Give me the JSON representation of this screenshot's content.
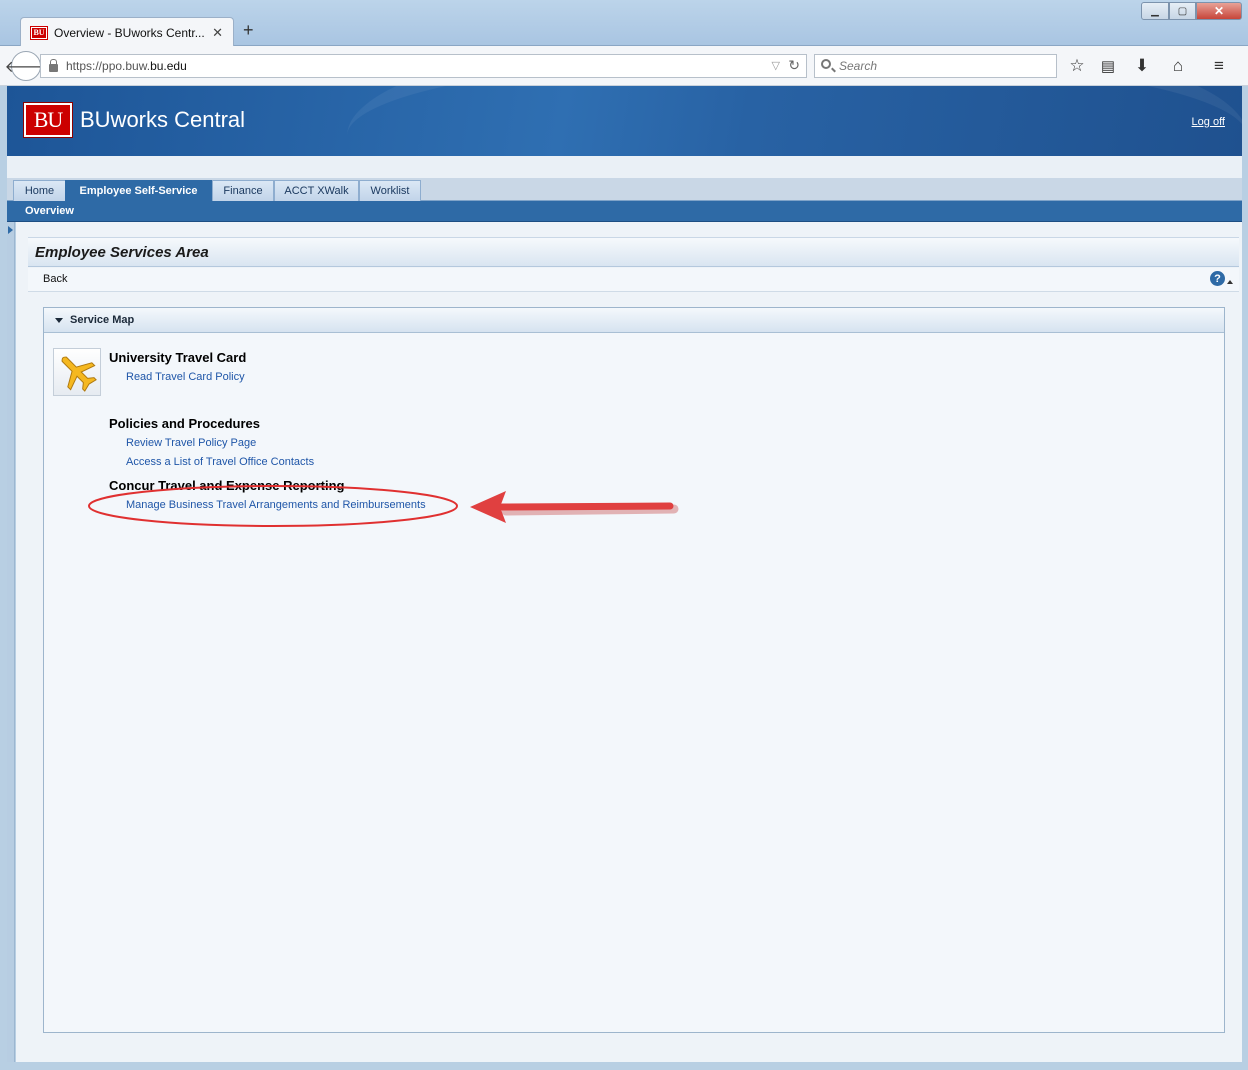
{
  "browser": {
    "tab_title": "Overview - BUworks Centr...",
    "tab_favicon_text": "BU",
    "url_prefix": "https://ppo.buw.",
    "url_domain": "bu.edu",
    "search_placeholder": "Search",
    "icons": [
      "back-arrow-icon",
      "lock-icon",
      "reload-icon",
      "search-icon",
      "bookmark-star-icon",
      "reading-list-icon",
      "download-icon",
      "home-icon",
      "menu-icon"
    ]
  },
  "header": {
    "logo_text": "BU",
    "app_title": "BUworks Central",
    "logoff_label": "Log off"
  },
  "nav": {
    "tabs": [
      {
        "label": "Home",
        "active": false
      },
      {
        "label": "Employee Self-Service",
        "active": true
      },
      {
        "label": "Finance",
        "active": false
      },
      {
        "label": "ACCT XWalk",
        "active": false
      },
      {
        "label": "Worklist",
        "active": false
      }
    ],
    "subtab": "Overview"
  },
  "page": {
    "title": "Employee Services Area",
    "back_label": "Back",
    "help_icon": "?"
  },
  "service_map": {
    "title": "Service Map",
    "sections": [
      {
        "heading": "University Travel Card",
        "links": [
          "Read Travel Card Policy"
        ]
      },
      {
        "heading": "Policies and Procedures",
        "links": [
          "Review Travel Policy Page",
          "Access a List of Travel Office Contacts"
        ]
      },
      {
        "heading": "Concur Travel and Expense Reporting",
        "links": [
          "Manage Business Travel Arrangements and Reimbursements"
        ]
      }
    ]
  },
  "colors": {
    "header_blue": "#2a64a8",
    "bu_red": "#cc0000",
    "link_blue": "#1f56a8",
    "annotation_red": "#e03030"
  }
}
